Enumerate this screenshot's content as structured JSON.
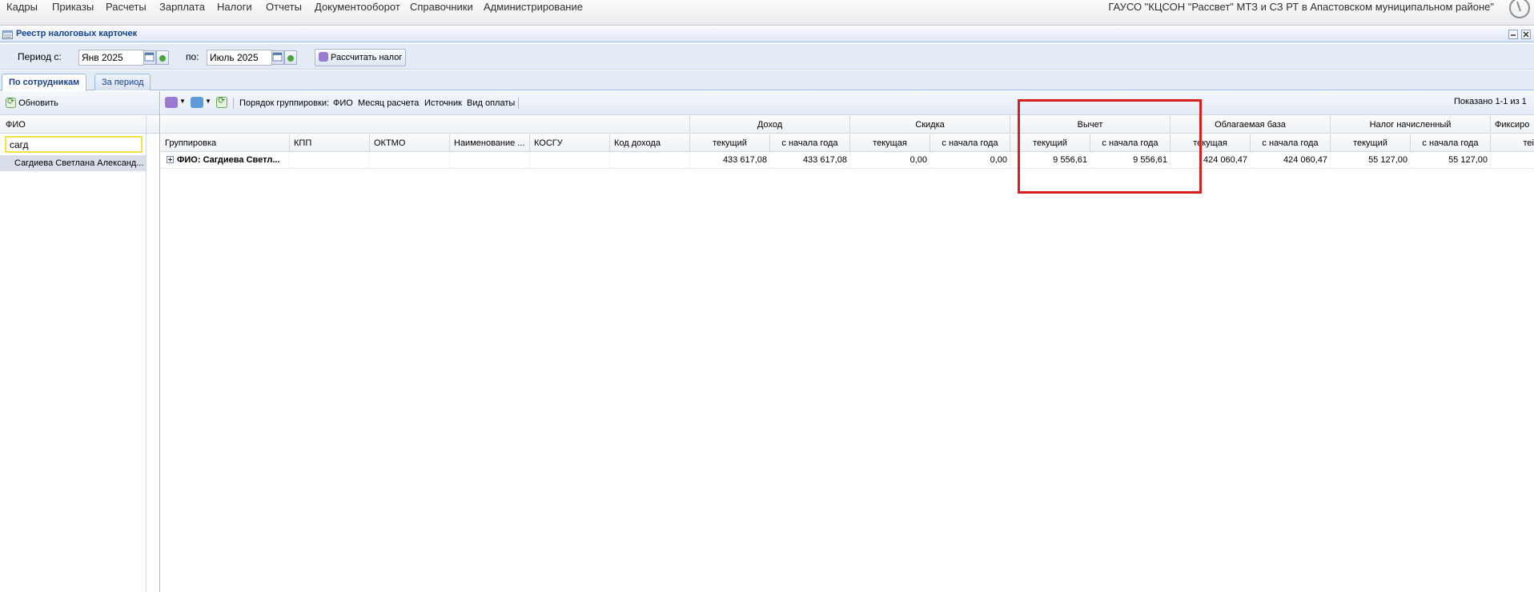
{
  "menu": {
    "items": [
      "Кадры",
      "Приказы",
      "Расчеты",
      "Зарплата",
      "Налоги",
      "Отчеты",
      "Документооборот",
      "Справочники",
      "Администрирование"
    ],
    "organization": "ГАУСО \"КЦСОН \"Рассвет\" МТЗ и СЗ РТ в Апастовском муниципальном районе\""
  },
  "window": {
    "title": "Реестр налоговых карточек"
  },
  "period": {
    "from_label": "Период с:",
    "from_value": "Янв 2025",
    "to_label": "по:",
    "to_value": "Июль 2025",
    "calc_button": "Рассчитать налог"
  },
  "tabs": [
    "По сотрудникам",
    "За период"
  ],
  "left": {
    "refresh": "Обновить",
    "column": "ФИО",
    "filter_value": "сагд",
    "items": [
      "Сагдиева Светлана Александ..."
    ]
  },
  "grid": {
    "grouping_label": "Порядок группировки:",
    "grouping_items": [
      "ФИО",
      "Месяц расчета",
      "Источник",
      "Вид оплаты"
    ],
    "paging": "Показано 1-1 из 1",
    "groups": [
      "Доход",
      "Скидка",
      "Вычет",
      "Облагаемая база",
      "Налог начисленный",
      "Фиксиро"
    ],
    "columns": [
      "Группировка",
      "КПП",
      "ОКТМО",
      "Наименование ...",
      "КОСГУ",
      "Код дохода"
    ],
    "sub": {
      "current": "текущий",
      "current_f": "текущая",
      "ytd": "с начала года",
      "trunc": "теі"
    },
    "row": {
      "group": "ФИО: Сагдиева Светл...",
      "income_cur": "433 617,08",
      "income_ytd": "433 617,08",
      "disc_cur": "0,00",
      "disc_ytd": "0,00",
      "ded_cur": "9 556,61",
      "ded_ytd": "9 556,61",
      "base_cur": "424 060,47",
      "base_ytd": "424 060,47",
      "tax_cur": "55 127,00",
      "tax_ytd": "55 127,00"
    }
  }
}
